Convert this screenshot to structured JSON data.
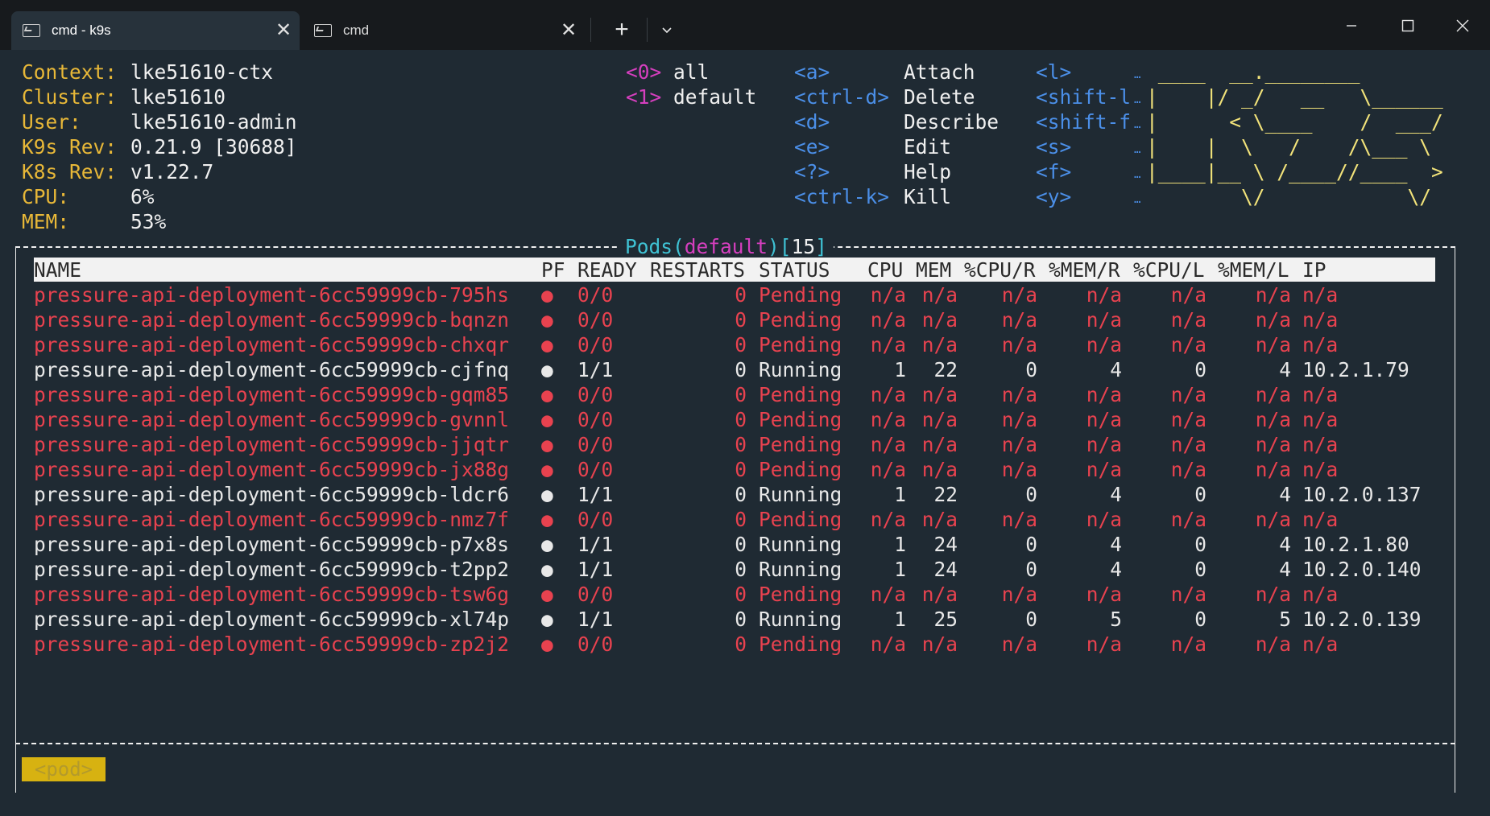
{
  "tabs": [
    {
      "label": "cmd - k9s",
      "active": true
    },
    {
      "label": "cmd",
      "active": false
    }
  ],
  "info": [
    {
      "label": "Context:",
      "value": "lke51610-ctx"
    },
    {
      "label": "Cluster:",
      "value": "lke51610"
    },
    {
      "label": "User:",
      "value": "lke51610-admin"
    },
    {
      "label": "K9s Rev:",
      "value": "0.21.9 [30688]"
    },
    {
      "label": "K8s Rev:",
      "value": "v1.22.7"
    },
    {
      "label": "CPU:",
      "value": "6%"
    },
    {
      "label": "MEM:",
      "value": "53%"
    }
  ],
  "namespaces": [
    {
      "key": "<0>",
      "name": "all"
    },
    {
      "key": "<1>",
      "name": "default"
    }
  ],
  "shortcuts": [
    {
      "key": "<a>",
      "action": "Attach"
    },
    {
      "key": "<ctrl-d>",
      "action": "Delete"
    },
    {
      "key": "<d>",
      "action": "Describe"
    },
    {
      "key": "<e>",
      "action": "Edit"
    },
    {
      "key": "<?>",
      "action": "Help"
    },
    {
      "key": "<ctrl-k>",
      "action": "Kill"
    }
  ],
  "shortcuts2": [
    {
      "key": "<l>"
    },
    {
      "key": "<shift-l"
    },
    {
      "key": "<shift-f"
    },
    {
      "key": "<s>"
    },
    {
      "key": "<f>"
    },
    {
      "key": "<y>"
    }
  ],
  "logo": [
    " ____  __.________       ",
    "|    |/ _/   __   \\______",
    "|      < \\____    /  ___/",
    "|    |  \\   /    /\\___ \\ ",
    "|____|__ \\ /____//____  >",
    "        \\/            \\/ "
  ],
  "view": {
    "resource": "Pods",
    "namespace": "default",
    "count": "15"
  },
  "columns": [
    "NAME",
    "PF",
    "READY",
    "RESTARTS",
    "STATUS",
    "CPU",
    "MEM",
    "%CPU/R",
    "%MEM/R",
    "%CPU/L",
    "%MEM/L",
    "IP"
  ],
  "pods": [
    {
      "name": "pressure-api-deployment-6cc59999cb-795hs",
      "pf": "●",
      "ready": "0/0",
      "restarts": "0",
      "status": "Pending",
      "cpu": "n/a",
      "mem": "n/a",
      "cpur": "n/a",
      "memr": "n/a",
      "cpul": "n/a",
      "meml": "n/a",
      "ip": "n/a"
    },
    {
      "name": "pressure-api-deployment-6cc59999cb-bqnzn",
      "pf": "●",
      "ready": "0/0",
      "restarts": "0",
      "status": "Pending",
      "cpu": "n/a",
      "mem": "n/a",
      "cpur": "n/a",
      "memr": "n/a",
      "cpul": "n/a",
      "meml": "n/a",
      "ip": "n/a"
    },
    {
      "name": "pressure-api-deployment-6cc59999cb-chxqr",
      "pf": "●",
      "ready": "0/0",
      "restarts": "0",
      "status": "Pending",
      "cpu": "n/a",
      "mem": "n/a",
      "cpur": "n/a",
      "memr": "n/a",
      "cpul": "n/a",
      "meml": "n/a",
      "ip": "n/a"
    },
    {
      "name": "pressure-api-deployment-6cc59999cb-cjfnq",
      "pf": "●",
      "ready": "1/1",
      "restarts": "0",
      "status": "Running",
      "cpu": "1",
      "mem": "22",
      "cpur": "0",
      "memr": "4",
      "cpul": "0",
      "meml": "4",
      "ip": "10.2.1.79"
    },
    {
      "name": "pressure-api-deployment-6cc59999cb-gqm85",
      "pf": "●",
      "ready": "0/0",
      "restarts": "0",
      "status": "Pending",
      "cpu": "n/a",
      "mem": "n/a",
      "cpur": "n/a",
      "memr": "n/a",
      "cpul": "n/a",
      "meml": "n/a",
      "ip": "n/a"
    },
    {
      "name": "pressure-api-deployment-6cc59999cb-gvnnl",
      "pf": "●",
      "ready": "0/0",
      "restarts": "0",
      "status": "Pending",
      "cpu": "n/a",
      "mem": "n/a",
      "cpur": "n/a",
      "memr": "n/a",
      "cpul": "n/a",
      "meml": "n/a",
      "ip": "n/a"
    },
    {
      "name": "pressure-api-deployment-6cc59999cb-jjqtr",
      "pf": "●",
      "ready": "0/0",
      "restarts": "0",
      "status": "Pending",
      "cpu": "n/a",
      "mem": "n/a",
      "cpur": "n/a",
      "memr": "n/a",
      "cpul": "n/a",
      "meml": "n/a",
      "ip": "n/a"
    },
    {
      "name": "pressure-api-deployment-6cc59999cb-jx88g",
      "pf": "●",
      "ready": "0/0",
      "restarts": "0",
      "status": "Pending",
      "cpu": "n/a",
      "mem": "n/a",
      "cpur": "n/a",
      "memr": "n/a",
      "cpul": "n/a",
      "meml": "n/a",
      "ip": "n/a"
    },
    {
      "name": "pressure-api-deployment-6cc59999cb-ldcr6",
      "pf": "●",
      "ready": "1/1",
      "restarts": "0",
      "status": "Running",
      "cpu": "1",
      "mem": "22",
      "cpur": "0",
      "memr": "4",
      "cpul": "0",
      "meml": "4",
      "ip": "10.2.0.137"
    },
    {
      "name": "pressure-api-deployment-6cc59999cb-nmz7f",
      "pf": "●",
      "ready": "0/0",
      "restarts": "0",
      "status": "Pending",
      "cpu": "n/a",
      "mem": "n/a",
      "cpur": "n/a",
      "memr": "n/a",
      "cpul": "n/a",
      "meml": "n/a",
      "ip": "n/a"
    },
    {
      "name": "pressure-api-deployment-6cc59999cb-p7x8s",
      "pf": "●",
      "ready": "1/1",
      "restarts": "0",
      "status": "Running",
      "cpu": "1",
      "mem": "24",
      "cpur": "0",
      "memr": "4",
      "cpul": "0",
      "meml": "4",
      "ip": "10.2.1.80"
    },
    {
      "name": "pressure-api-deployment-6cc59999cb-t2pp2",
      "pf": "●",
      "ready": "1/1",
      "restarts": "0",
      "status": "Running",
      "cpu": "1",
      "mem": "24",
      "cpur": "0",
      "memr": "4",
      "cpul": "0",
      "meml": "4",
      "ip": "10.2.0.140"
    },
    {
      "name": "pressure-api-deployment-6cc59999cb-tsw6g",
      "pf": "●",
      "ready": "0/0",
      "restarts": "0",
      "status": "Pending",
      "cpu": "n/a",
      "mem": "n/a",
      "cpur": "n/a",
      "memr": "n/a",
      "cpul": "n/a",
      "meml": "n/a",
      "ip": "n/a"
    },
    {
      "name": "pressure-api-deployment-6cc59999cb-xl74p",
      "pf": "●",
      "ready": "1/1",
      "restarts": "0",
      "status": "Running",
      "cpu": "1",
      "mem": "25",
      "cpur": "0",
      "memr": "5",
      "cpul": "0",
      "meml": "5",
      "ip": "10.2.0.139"
    },
    {
      "name": "pressure-api-deployment-6cc59999cb-zp2j2",
      "pf": "●",
      "ready": "0/0",
      "restarts": "0",
      "status": "Pending",
      "cpu": "n/a",
      "mem": "n/a",
      "cpur": "n/a",
      "memr": "n/a",
      "cpul": "n/a",
      "meml": "n/a",
      "ip": "n/a"
    }
  ],
  "crumb": "<pod>",
  "colors": {
    "pending": "#e8424f",
    "running": "#e8e8e8",
    "label": "#e8b838",
    "key": "#4b8fe8",
    "ns_key": "#d63fbf",
    "logo": "#f2e37a"
  },
  "icons": {
    "tab": "terminal-icon",
    "close": "close-icon",
    "new_tab": "plus-icon",
    "dropdown": "chevron-down-icon",
    "minimize": "minimize-icon",
    "maximize": "maximize-icon",
    "window_close": "window-close-icon"
  }
}
